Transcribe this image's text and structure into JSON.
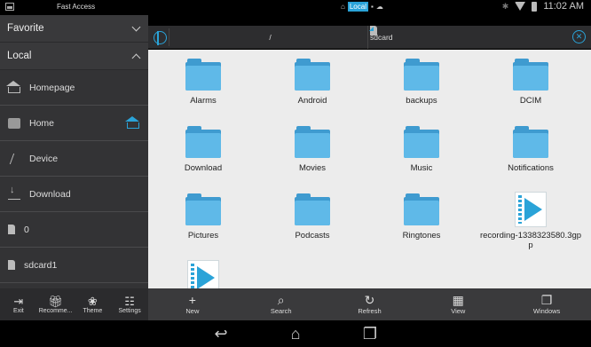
{
  "status_bar": {
    "title": "Fast Access",
    "storage_label": "Local",
    "time": "11:02 AM"
  },
  "sidebar": {
    "sections": [
      {
        "label": "Favorite",
        "expanded": false
      },
      {
        "label": "Local",
        "expanded": true
      }
    ],
    "items": [
      {
        "label": "Homepage",
        "icon": "house-icon"
      },
      {
        "label": "Home",
        "icon": "camera-icon"
      },
      {
        "label": "Device",
        "icon": "slash-icon"
      },
      {
        "label": "Download",
        "icon": "download-icon"
      },
      {
        "label": "0",
        "icon": "sdcard-icon"
      },
      {
        "label": "sdcard1",
        "icon": "sdcard-icon"
      }
    ],
    "toolbar": [
      {
        "label": "Exit",
        "icon": "exit-icon"
      },
      {
        "label": "Recomme...",
        "icon": "gift-icon"
      },
      {
        "label": "Theme",
        "icon": "palette-icon"
      },
      {
        "label": "Settings",
        "icon": "sliders-icon"
      }
    ]
  },
  "path_bar": {
    "crumbs": [
      "/",
      "sdcard"
    ]
  },
  "files": [
    {
      "name": "Alarms",
      "type": "folder"
    },
    {
      "name": "Android",
      "type": "folder"
    },
    {
      "name": "backups",
      "type": "folder"
    },
    {
      "name": "DCIM",
      "type": "folder"
    },
    {
      "name": "Download",
      "type": "folder"
    },
    {
      "name": "Movies",
      "type": "folder"
    },
    {
      "name": "Music",
      "type": "folder"
    },
    {
      "name": "Notifications",
      "type": "folder"
    },
    {
      "name": "Pictures",
      "type": "folder"
    },
    {
      "name": "Podcasts",
      "type": "folder"
    },
    {
      "name": "Ringtones",
      "type": "folder"
    },
    {
      "name": "recording-1338323580.3gpp",
      "type": "video"
    },
    {
      "name": "",
      "type": "video"
    }
  ],
  "main_toolbar": [
    {
      "label": "New",
      "icon": "plus-icon"
    },
    {
      "label": "Search",
      "icon": "search-icon"
    },
    {
      "label": "Refresh",
      "icon": "refresh-icon"
    },
    {
      "label": "View",
      "icon": "grid-icon"
    },
    {
      "label": "Windows",
      "icon": "windows-icon"
    }
  ],
  "colors": {
    "accent": "#2aa3d8",
    "folder": "#5fb9e8",
    "sidebar_bg": "#333335",
    "content_bg": "#ececec"
  }
}
